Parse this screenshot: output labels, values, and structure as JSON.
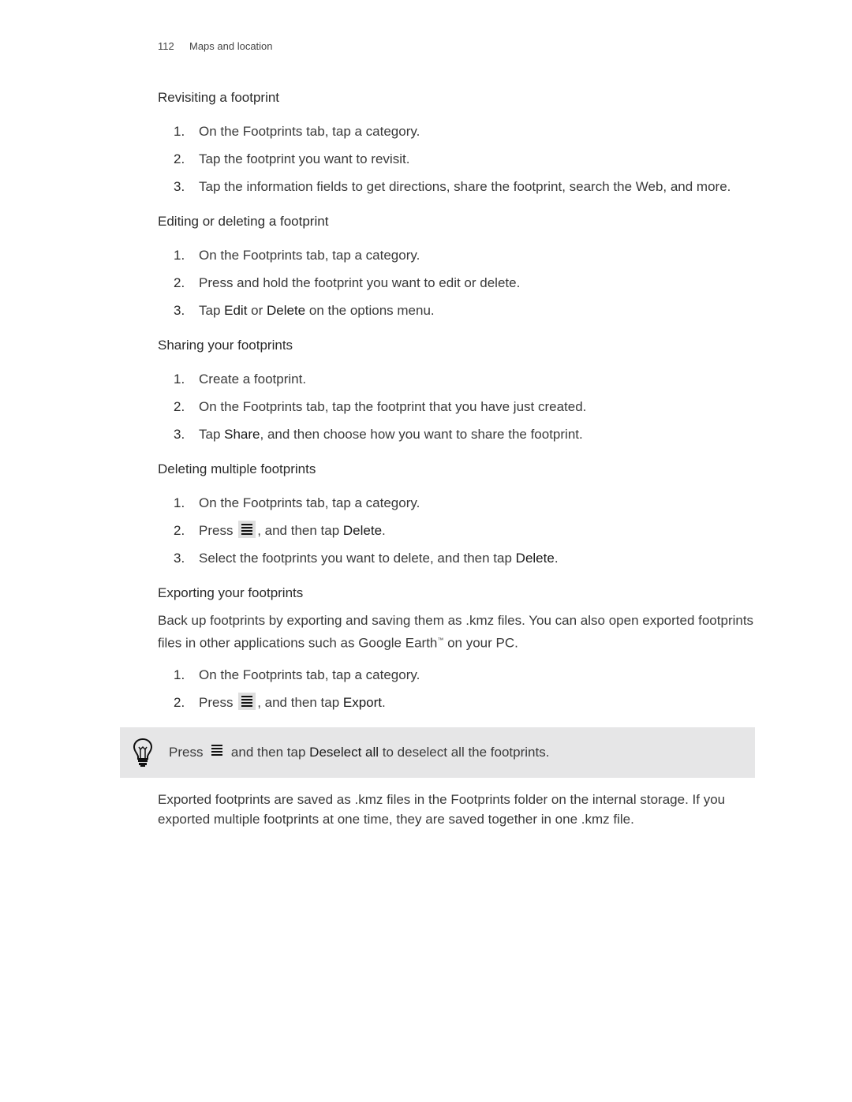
{
  "header": {
    "page_number": "112",
    "chapter": "Maps and location"
  },
  "sections": [
    {
      "title": "Revisiting a footprint",
      "steps": [
        {
          "num": "1.",
          "text": "On the Footprints tab, tap a category."
        },
        {
          "num": "2.",
          "text": "Tap the footprint you want to revisit."
        },
        {
          "num": "3.",
          "text": "Tap the information fields to get directions, share the footprint, search the Web, and more."
        }
      ]
    },
    {
      "title": "Editing or deleting a footprint",
      "steps": [
        {
          "num": "1.",
          "text": "On the Footprints tab, tap a category."
        },
        {
          "num": "2.",
          "text": "Press and hold the footprint you want to edit or delete."
        },
        {
          "num": "3.",
          "pre": "Tap ",
          "em1": "Edit",
          "mid": " or ",
          "em2": "Delete",
          "post": " on the options menu."
        }
      ]
    },
    {
      "title": "Sharing your footprints",
      "steps": [
        {
          "num": "1.",
          "text": "Create a footprint."
        },
        {
          "num": "2.",
          "text": "On the Footprints tab, tap the footprint that you have just created."
        },
        {
          "num": "3.",
          "pre": "Tap ",
          "em1": "Share",
          "post": ", and then choose how you want to share the footprint."
        }
      ]
    },
    {
      "title": "Deleting multiple footprints",
      "steps": [
        {
          "num": "1.",
          "text": "On the Footprints tab, tap a category."
        },
        {
          "num": "2.",
          "pre": "Press ",
          "icon": "menu-icon",
          "post": ", and then tap ",
          "em1": "Delete",
          "end": "."
        },
        {
          "num": "3.",
          "pre": "Select the footprints you want to delete, and then tap ",
          "em1": "Delete",
          "end": "."
        }
      ]
    },
    {
      "title": "Exporting your footprints",
      "intro_pre": "Back up footprints by exporting and saving them as .kmz files. You can also open exported footprints files in other applications such as Google Earth",
      "intro_tm": "™",
      "intro_post": " on your PC.",
      "steps": [
        {
          "num": "1.",
          "text": "On the Footprints tab, tap a category."
        },
        {
          "num": "2.",
          "pre": "Press ",
          "icon": "menu-icon",
          "post": ", and then tap ",
          "em1": "Export",
          "end": "."
        }
      ]
    }
  ],
  "tip": {
    "icon": "lightbulb-icon",
    "pre": "Press ",
    "mid": " and then tap ",
    "em": "Deselect all",
    "post": " to deselect all the footprints."
  },
  "closing_paragraph": "Exported footprints are saved as .kmz files in the Footprints folder on the internal storage. If you exported multiple footprints at one time, they are saved together in one .kmz file."
}
